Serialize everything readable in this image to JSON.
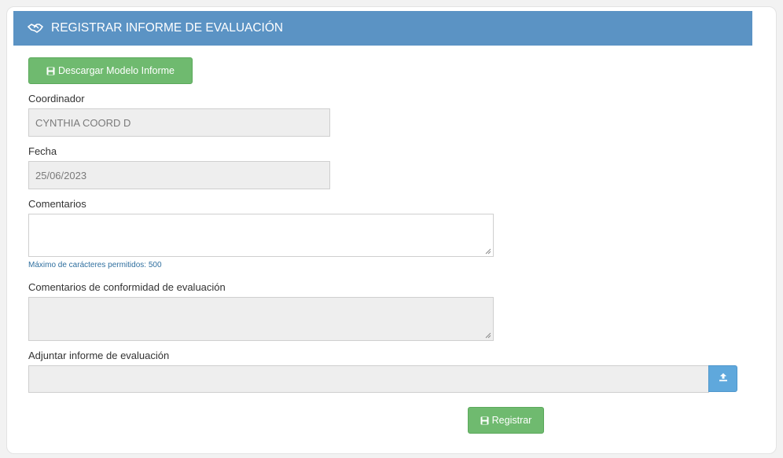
{
  "form": {
    "title": "REGISTRAR INFORME DE EVALUACIÓN",
    "title_icon": "handshake-icon",
    "download_button": {
      "label": "Descargar Modelo Informe",
      "icon": "floppy-disk-icon"
    },
    "coordinator": {
      "label": "Coordinador",
      "value": "CYNTHIA  COORD D"
    },
    "date": {
      "label": "Fecha",
      "value": "25/06/2023"
    },
    "comments": {
      "label": "Comentarios",
      "value": "",
      "hint": "Máximo de carácteres permitidos: 500"
    },
    "conformity_comments": {
      "label": "Comentarios de conformidad de evaluación",
      "value": ""
    },
    "attachment": {
      "label": "Adjuntar informe de evaluación",
      "value": "",
      "upload_icon": "upload-icon"
    },
    "submit_button": {
      "label": "Registrar",
      "icon": "floppy-disk-icon"
    }
  },
  "colors": {
    "header": "#5b93c4",
    "success_button": "#6fba6f",
    "upload_button": "#5fa8dc",
    "hint_text": "#2f6f9f",
    "disabled_field": "#eeeeee"
  }
}
